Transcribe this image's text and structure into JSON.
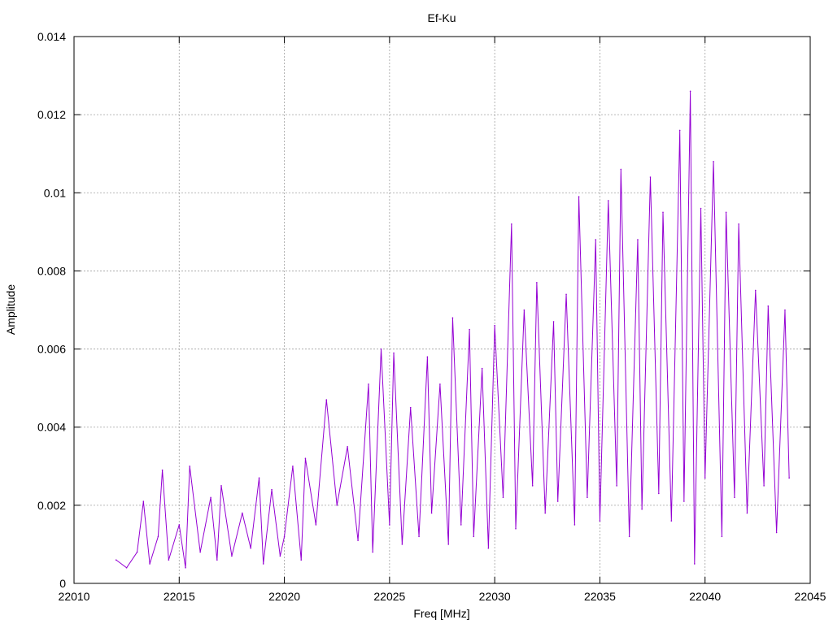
{
  "chart_data": {
    "type": "line",
    "title": "Ef-Ku",
    "xlabel": "Freq [MHz]",
    "ylabel": "Amplitude",
    "xlim": [
      22010,
      22045
    ],
    "ylim": [
      0,
      0.014
    ],
    "xticks": [
      22010,
      22015,
      22020,
      22025,
      22030,
      22035,
      22040,
      22045
    ],
    "xtick_labels": [
      "22010",
      "22015",
      "22020",
      "22025",
      "22030",
      "22035",
      "22040",
      "22045"
    ],
    "yticks": [
      0,
      0.002,
      0.004,
      0.006,
      0.008,
      0.01,
      0.012,
      0.014
    ],
    "ytick_labels": [
      "0",
      "0.002",
      "0.004",
      "0.006",
      "0.008",
      "0.01",
      "0.012",
      "0.014"
    ],
    "grid": true,
    "series_color": "#9400d3",
    "series": [
      {
        "x": [
          22012.0,
          22012.5,
          22013.0,
          22013.3,
          22013.6,
          22014.0,
          22014.2,
          22014.5,
          22015.0,
          22015.3,
          22015.5,
          22016.0,
          22016.5,
          22016.8,
          22017.0,
          22017.5,
          22018.0,
          22018.4,
          22018.8,
          22019.0,
          22019.4,
          22019.8,
          22020.0,
          22020.4,
          22020.8,
          22021.0,
          22021.5,
          22022.0,
          22022.5,
          22023.0,
          22023.5,
          22024.0,
          22024.2,
          22024.6,
          22025.0,
          22025.2,
          22025.6,
          22026.0,
          22026.4,
          22026.8,
          22027.0,
          22027.4,
          22027.8,
          22028.0,
          22028.4,
          22028.8,
          22029.0,
          22029.4,
          22029.7,
          22030.0,
          22030.4,
          22030.8,
          22031.0,
          22031.4,
          22031.8,
          22032.0,
          22032.4,
          22032.8,
          22033.0,
          22033.4,
          22033.8,
          22034.0,
          22034.4,
          22034.8,
          22035.0,
          22035.4,
          22035.8,
          22036.0,
          22036.4,
          22036.8,
          22037.0,
          22037.4,
          22037.8,
          22038.0,
          22038.4,
          22038.8,
          22039.0,
          22039.3,
          22039.5,
          22039.8,
          22040.0,
          22040.4,
          22040.8,
          22041.0,
          22041.4,
          22041.6,
          22042.0,
          22042.4,
          22042.8,
          22043.0,
          22043.4,
          22043.8,
          22044.0
        ],
        "y": [
          0.0006,
          0.0004,
          0.0008,
          0.0021,
          0.0005,
          0.0012,
          0.0029,
          0.0006,
          0.0015,
          0.0004,
          0.003,
          0.0008,
          0.0022,
          0.0006,
          0.0025,
          0.0007,
          0.0018,
          0.0009,
          0.0027,
          0.0005,
          0.0024,
          0.0007,
          0.0012,
          0.003,
          0.0006,
          0.0032,
          0.0015,
          0.0047,
          0.002,
          0.0035,
          0.0011,
          0.0051,
          0.0008,
          0.006,
          0.0015,
          0.0059,
          0.001,
          0.0045,
          0.0012,
          0.0058,
          0.0018,
          0.0051,
          0.001,
          0.0068,
          0.0015,
          0.0065,
          0.0012,
          0.0055,
          0.0009,
          0.0066,
          0.0022,
          0.0092,
          0.0014,
          0.007,
          0.0025,
          0.0077,
          0.0018,
          0.0067,
          0.0021,
          0.0074,
          0.0015,
          0.0099,
          0.0022,
          0.0088,
          0.0016,
          0.0098,
          0.0025,
          0.0106,
          0.0012,
          0.0088,
          0.0019,
          0.0104,
          0.0023,
          0.0095,
          0.0016,
          0.0116,
          0.0021,
          0.0126,
          0.0005,
          0.0096,
          0.0027,
          0.0108,
          0.0012,
          0.0095,
          0.0022,
          0.0092,
          0.0018,
          0.0075,
          0.0025,
          0.0071,
          0.0013,
          0.007,
          0.0027
        ]
      }
    ]
  }
}
